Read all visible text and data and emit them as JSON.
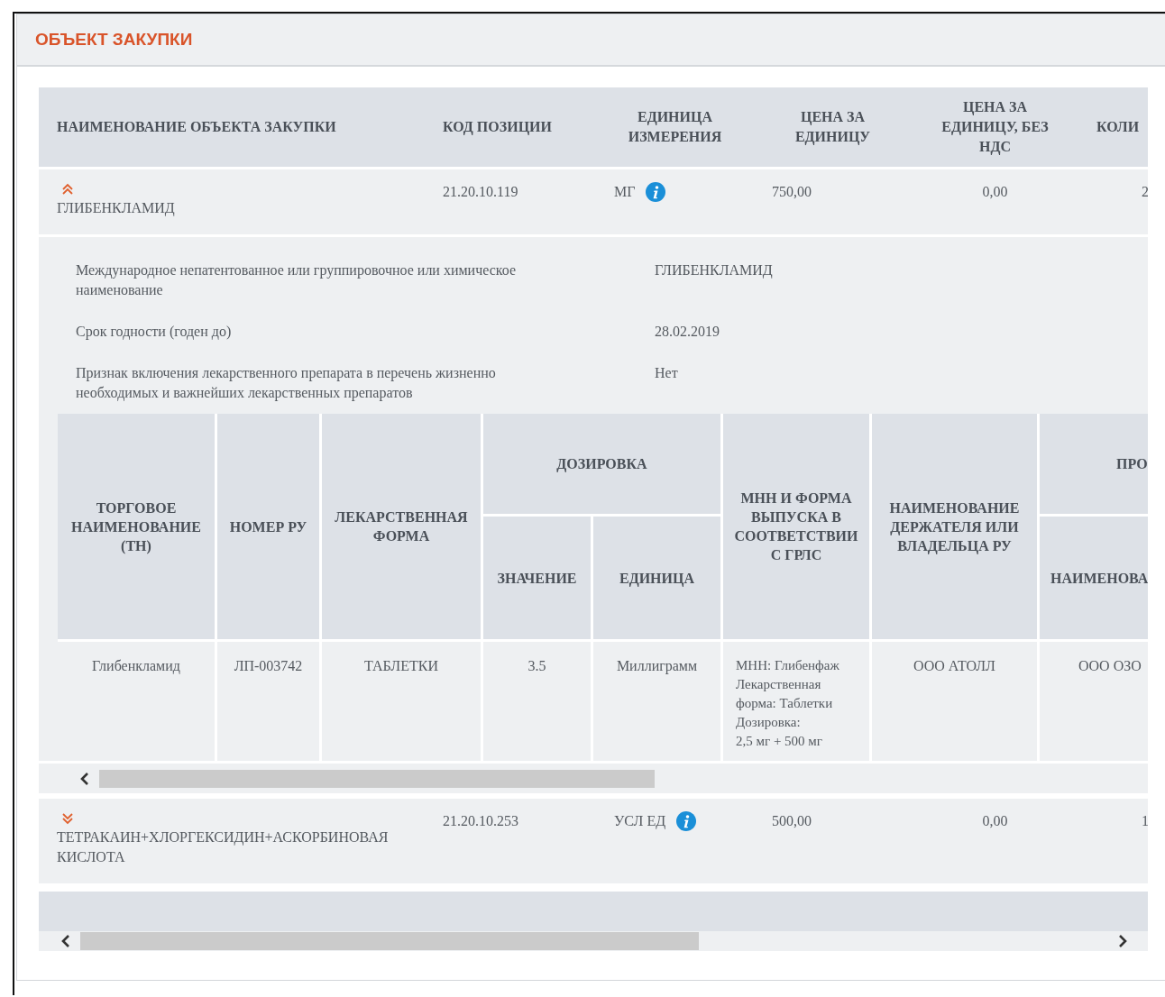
{
  "panel": {
    "title": "ОБЪЕКТ ЗАКУПКИ"
  },
  "table": {
    "columns": [
      "НАИМЕНОВАНИЕ ОБЪЕКТА ЗАКУПКИ",
      "КОД ПОЗИЦИИ",
      "ЕДИНИЦА ИЗМЕРЕНИЯ",
      "ЦЕНА ЗА ЕДИНИЦУ",
      "ЦЕНА ЗА ЕДИНИЦУ, БЕЗ НДС",
      "КОЛИ"
    ],
    "rows": [
      {
        "expanded": true,
        "name": "ГЛИБЕНКЛАМИД",
        "code": "21.20.10.119",
        "unit": "МГ",
        "price": "750,00",
        "price_no_vat": "0,00",
        "column_6": "2",
        "details": {
          "fields": [
            {
              "label": "Международное непатентованное или группировочное или химическое наименование",
              "value": "ГЛИБЕНКЛАМИД"
            },
            {
              "label": "Срок годности (годен до)",
              "value": "28.02.2019"
            },
            {
              "label": "Признак включения лекарственного препарата в перечень жизненно необходимых и важнейших лекарственных препаратов",
              "value": "Нет"
            }
          ],
          "drugs": {
            "columns": [
              {
                "label": "ТОРГОВОЕ НАИМЕНОВАНИЕ (ТН)"
              },
              {
                "label": "НОМЕР РУ"
              },
              {
                "label": "ЛЕКАРСТВЕННАЯ ФОРМА"
              },
              {
                "label": "ЗНАЧЕНИЕ",
                "group": "ДОЗИРОВКА"
              },
              {
                "label": "ЕДИНИЦА",
                "grouped": true
              },
              {
                "label": "МНН И ФОРМА ВЫПУСКА В СООТВЕТСТВИИ С ГРЛС"
              },
              {
                "label": "НАИМЕНОВАНИЕ ДЕРЖАТЕЛЯ ИЛИ ВЛАДЕЛЬЦА РУ"
              },
              {
                "label": "НАИМЕНОВА",
                "group": "ПРО"
              }
            ],
            "rows": [
              [
                "Глибенкламид",
                "ЛП-003742",
                "ТАБЛЕТКИ",
                "3.5",
                "Миллиграмм",
                "МНН: Глибенфаж\nЛекарственная\nформа: Таблетки\nДозировка:\n2,5 мг + 500 мг",
                "ООО АТОЛЛ",
                "ООО ОЗО"
              ]
            ]
          }
        }
      },
      {
        "expanded": false,
        "name": "ТЕТРАКАИН+ХЛОРГЕКСИДИН+АСКОРБИНОВАЯ КИСЛОТА",
        "code": "21.20.10.253",
        "unit": "УСЛ ЕД",
        "price": "500,00",
        "price_no_vat": "0,00",
        "column_6": "1"
      }
    ]
  }
}
